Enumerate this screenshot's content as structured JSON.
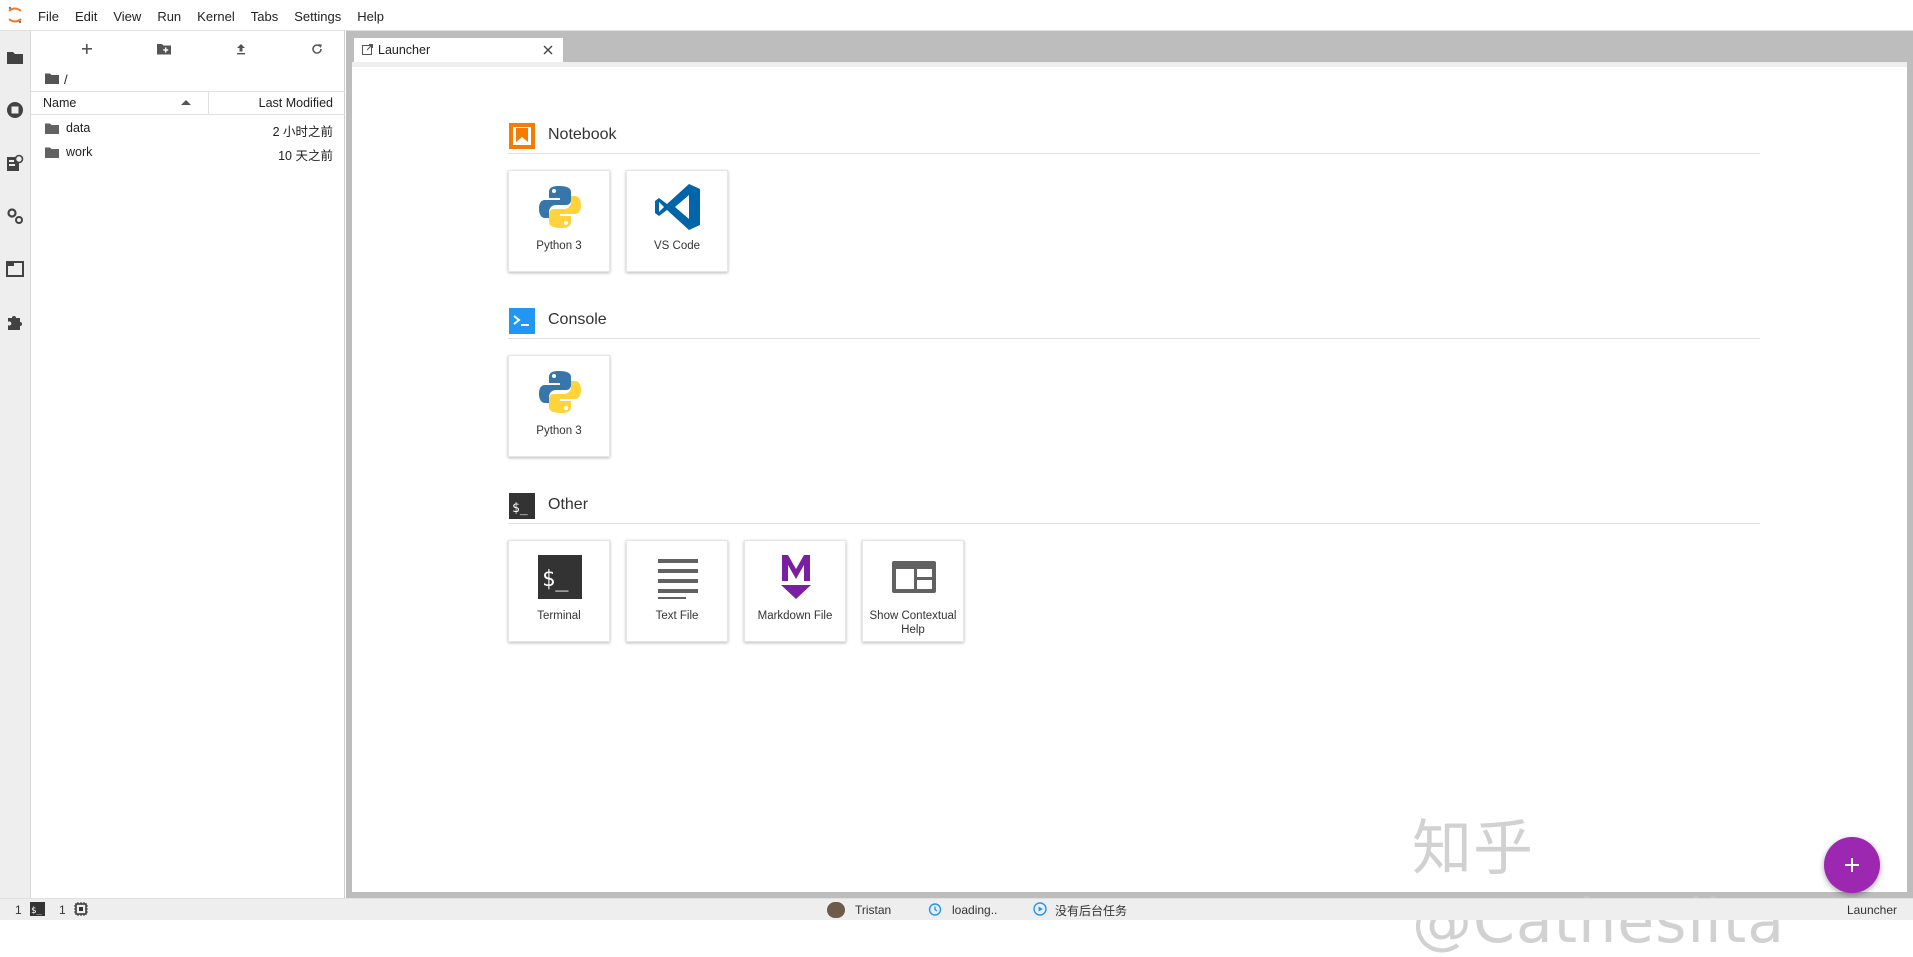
{
  "menubar": {
    "items": [
      "File",
      "Edit",
      "View",
      "Run",
      "Kernel",
      "Tabs",
      "Settings",
      "Help"
    ]
  },
  "activitybar": {
    "icons": [
      "folder-icon",
      "running-icon",
      "property-inspector-icon",
      "commands-icon",
      "tabs-icon",
      "extension-icon"
    ]
  },
  "filebrowser": {
    "breadcrumb": "/",
    "columns": {
      "name": "Name",
      "modified": "Last Modified"
    },
    "rows": [
      {
        "name": "data",
        "modified": "2 小时之前"
      },
      {
        "name": "work",
        "modified": "10 天之前"
      }
    ]
  },
  "tabs": [
    {
      "label": "Launcher"
    }
  ],
  "launcher": {
    "sections": [
      {
        "title": "Notebook",
        "cards": [
          {
            "label": "Python 3",
            "icon": "python-icon"
          },
          {
            "label": "VS Code",
            "icon": "vscode-icon"
          }
        ]
      },
      {
        "title": "Console",
        "cards": [
          {
            "label": "Python 3",
            "icon": "python-icon"
          }
        ]
      },
      {
        "title": "Other",
        "cards": [
          {
            "label": "Terminal",
            "icon": "terminal-icon"
          },
          {
            "label": "Text File",
            "icon": "text-file-icon"
          },
          {
            "label": "Markdown File",
            "icon": "markdown-icon"
          },
          {
            "label": "Show Contextual Help",
            "icon": "contextual-help-icon"
          }
        ]
      }
    ]
  },
  "statusbar": {
    "terminals_count": "1",
    "kernels_count": "1",
    "user": "Tristan",
    "loading": "loading..",
    "background_tasks": "没有后台任务",
    "current_tab": "Launcher"
  },
  "watermark": "知乎 @Cathesilta",
  "colors": {
    "accent_purple": "#9c27b0",
    "notebook_orange": "#f57c00",
    "console_blue": "#2196f3",
    "vscode_blue": "#0065a9",
    "markdown_purple": "#7b1fa2"
  }
}
